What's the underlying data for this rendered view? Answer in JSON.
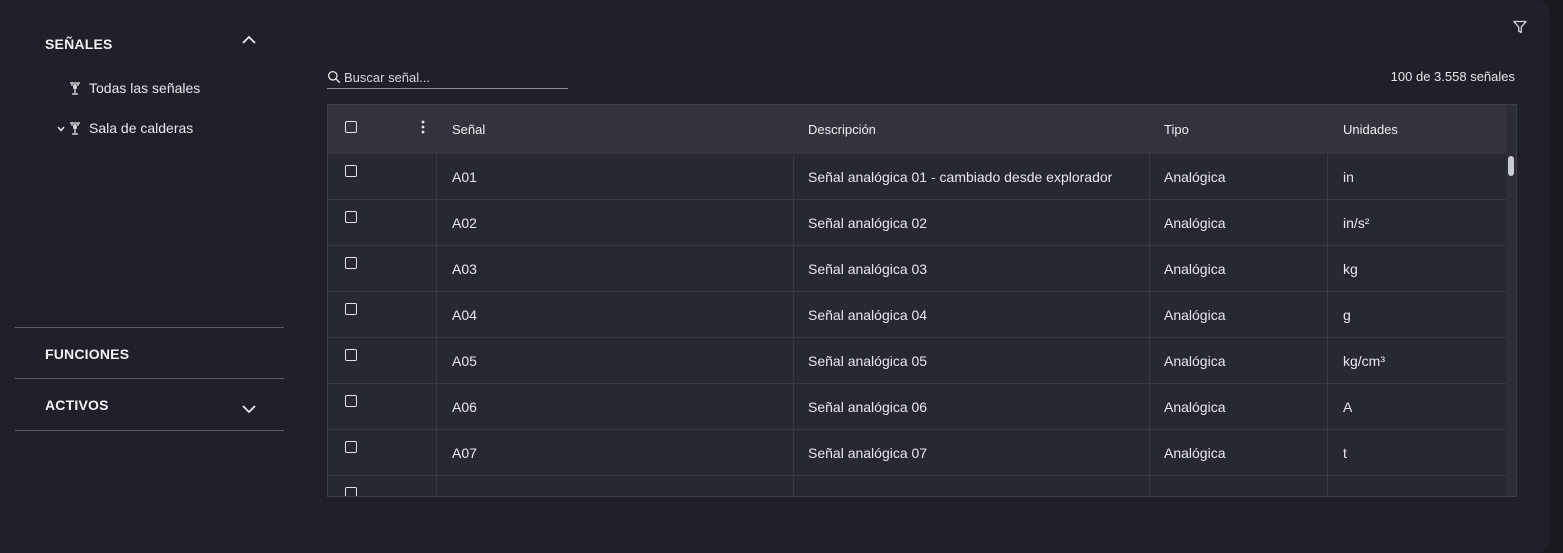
{
  "sidebar": {
    "senales": {
      "title": "SEÑALES",
      "items": [
        {
          "label": "Todas las señales"
        },
        {
          "label": "Sala de calderas"
        }
      ]
    },
    "funciones": {
      "title": "FUNCIONES"
    },
    "activos": {
      "title": "ACTIVOS"
    }
  },
  "toolbar": {
    "search_placeholder": "Buscar señal...",
    "count_text": "100 de 3.558 señales"
  },
  "table": {
    "columns": [
      "Señal",
      "Descripción",
      "Tipo",
      "Unidades"
    ],
    "rows": [
      {
        "senal": "A01",
        "descripcion": "Señal analógica 01 - cambiado desde explorador",
        "tipo": "Analógica",
        "unidades": "in"
      },
      {
        "senal": "A02",
        "descripcion": "Señal analógica 02",
        "tipo": "Analógica",
        "unidades": "in/s²"
      },
      {
        "senal": "A03",
        "descripcion": "Señal analógica 03",
        "tipo": "Analógica",
        "unidades": "kg"
      },
      {
        "senal": "A04",
        "descripcion": "Señal analógica 04",
        "tipo": "Analógica",
        "unidades": "g"
      },
      {
        "senal": "A05",
        "descripcion": "Señal analógica 05",
        "tipo": "Analógica",
        "unidades": "kg/cm³"
      },
      {
        "senal": "A06",
        "descripcion": "Señal analógica 06",
        "tipo": "Analógica",
        "unidades": "A"
      },
      {
        "senal": "A07",
        "descripcion": "Señal analógica 07",
        "tipo": "Analógica",
        "unidades": "t"
      },
      {
        "senal": "",
        "descripcion": "",
        "tipo": "",
        "unidades": ""
      }
    ]
  },
  "icons": {
    "filter": "filter-icon",
    "search": "search-icon",
    "collapse": "chevron-up-icon",
    "expand": "chevron-down-icon",
    "signal": "signal-tower-icon",
    "menu": "kebab-menu-icon"
  }
}
